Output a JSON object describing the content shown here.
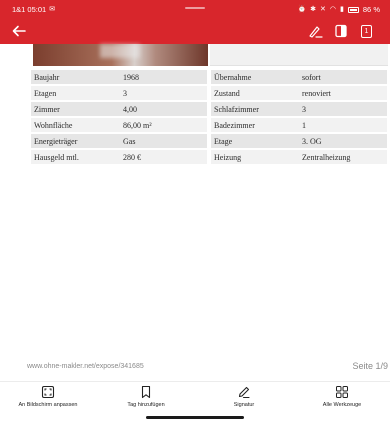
{
  "status_bar": {
    "carrier_time": "1&1 05:01",
    "battery": "86 %"
  },
  "toolbar": {
    "page_count": "1"
  },
  "specs_left": [
    {
      "key": "Baujahr",
      "value": "1968"
    },
    {
      "key": "Etagen",
      "value": "3"
    },
    {
      "key": "Zimmer",
      "value": "4,00"
    },
    {
      "key": "Wohnfläche",
      "value": "86,00 m²"
    },
    {
      "key": "Energieträger",
      "value": "Gas"
    },
    {
      "key": "Hausgeld mtl.",
      "value": "280 €"
    }
  ],
  "specs_right": [
    {
      "key": "Übernahme",
      "value": "sofort"
    },
    {
      "key": "Zustand",
      "value": "renoviert"
    },
    {
      "key": "Schlafzimmer",
      "value": "3"
    },
    {
      "key": "Badezimmer",
      "value": "1"
    },
    {
      "key": "Etage",
      "value": "3. OG"
    },
    {
      "key": "Heizung",
      "value": "Zentralheizung"
    }
  ],
  "document_footer": {
    "url": "www.ohne-makler.net/expose/341685",
    "page_indicator": "Seite 1/9"
  },
  "bottom_toolbar": [
    {
      "label": "An Bildschirm anpassen",
      "icon": "fit-screen-icon"
    },
    {
      "label": "Tag hinzufügen",
      "icon": "bookmark-icon"
    },
    {
      "label": "Signatur",
      "icon": "pen-icon"
    },
    {
      "label": "Alle Werkzeuge",
      "icon": "grid-icon"
    }
  ],
  "colors": {
    "accent": "#d8262c"
  }
}
